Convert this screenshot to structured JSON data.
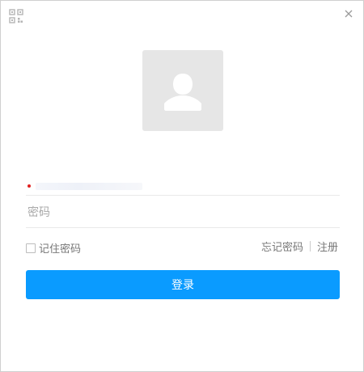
{
  "window": {
    "qr_icon": "qr-code-icon",
    "close_icon": "close-icon"
  },
  "avatar": {
    "icon": "user-silhouette-icon",
    "background": "#e6e6e6"
  },
  "form": {
    "account_value": "",
    "password_placeholder": "密码",
    "remember_label": "记住密码",
    "remember_checked": false,
    "forgot_password": "忘记密码",
    "register": "注册",
    "login_button": "登录"
  },
  "colors": {
    "accent": "#0a9bff",
    "text_muted": "#777777",
    "divider": "#e9e9e9"
  }
}
